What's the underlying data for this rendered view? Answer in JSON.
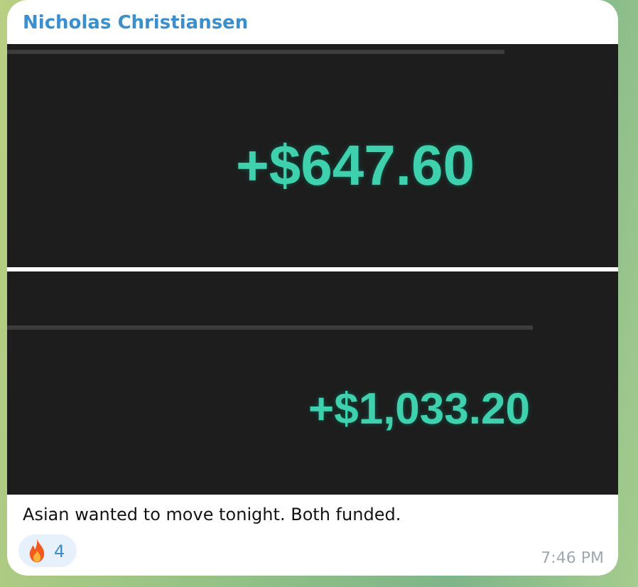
{
  "message": {
    "sender": "Nicholas Christiansen",
    "images": [
      {
        "kind": "centered",
        "amount": "+$647.60"
      },
      {
        "kind": "offset",
        "amount": "+$1,033.20"
      }
    ],
    "text": "Asian wanted to move tonight. Both funded.",
    "reactions": [
      {
        "count": "4"
      }
    ],
    "time": "7:46 PM"
  }
}
